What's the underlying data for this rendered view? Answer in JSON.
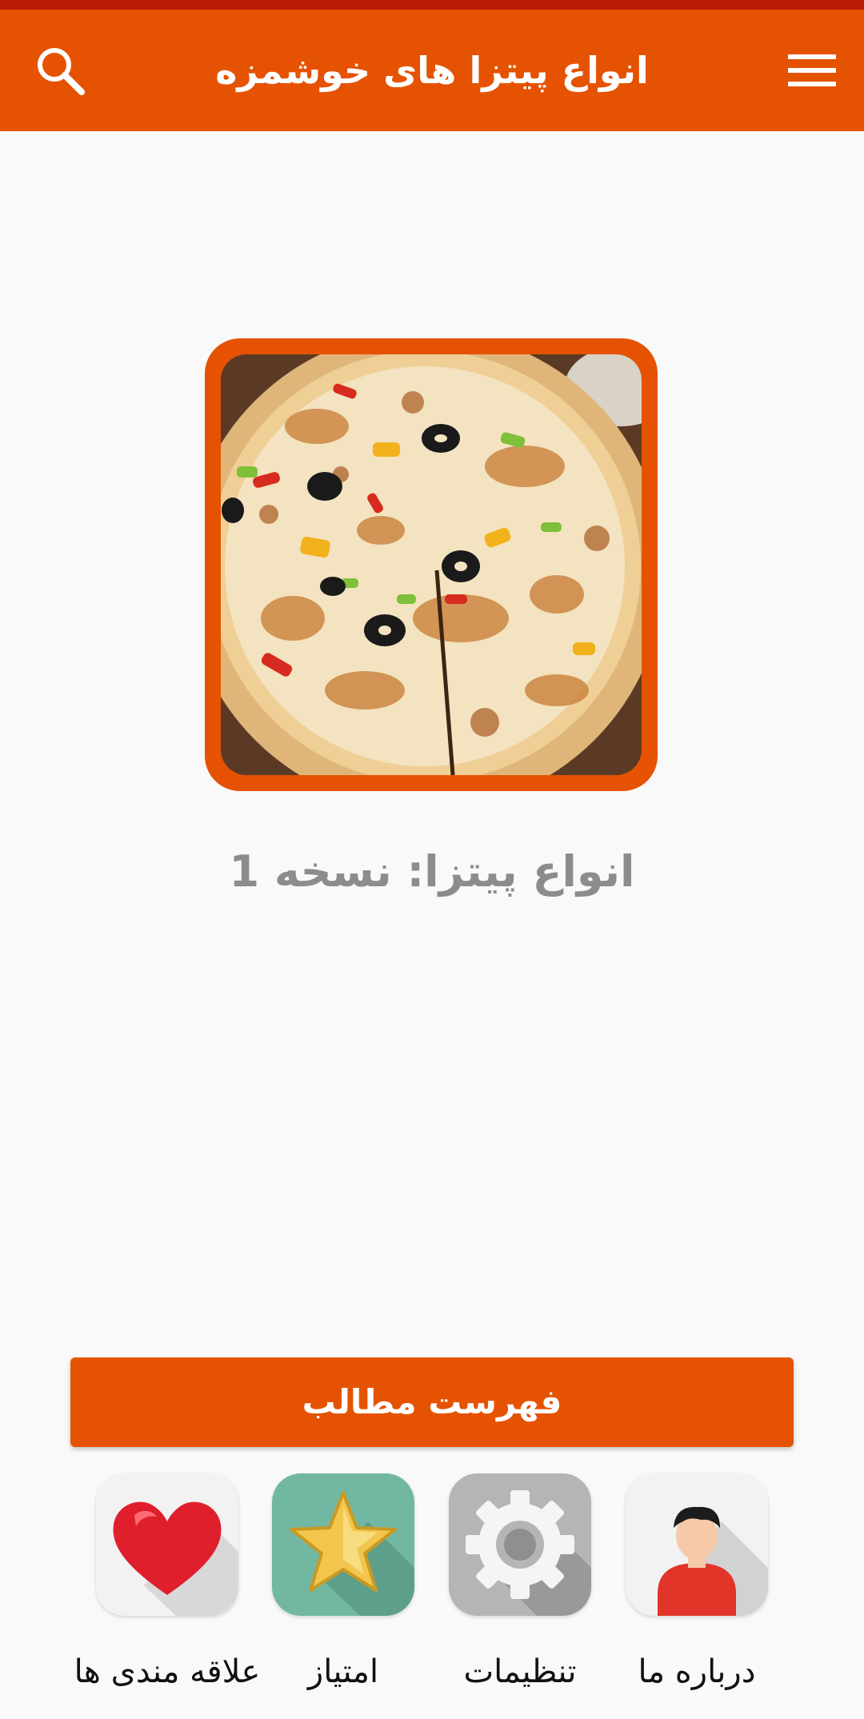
{
  "app_bar": {
    "title": "انواع پیتزا های خوشمزه",
    "menu_icon": "hamburger-menu-icon",
    "search_icon": "search-icon",
    "color": "#e55302"
  },
  "status_bar_color": "#b91b05",
  "hero": {
    "image": "pizza-photo",
    "frame_color": "#e55302"
  },
  "version_text": "انواع پیتزا: نسخه 1",
  "contents_button": {
    "label": "فهرست مطالب"
  },
  "shortcuts": [
    {
      "label": "درباره ما",
      "icon": "user-avatar-icon"
    },
    {
      "label": "تنظیمات",
      "icon": "gear-icon"
    },
    {
      "label": "امتیاز",
      "icon": "star-icon"
    },
    {
      "label": "علاقه مندی ها",
      "icon": "heart-icon"
    }
  ]
}
